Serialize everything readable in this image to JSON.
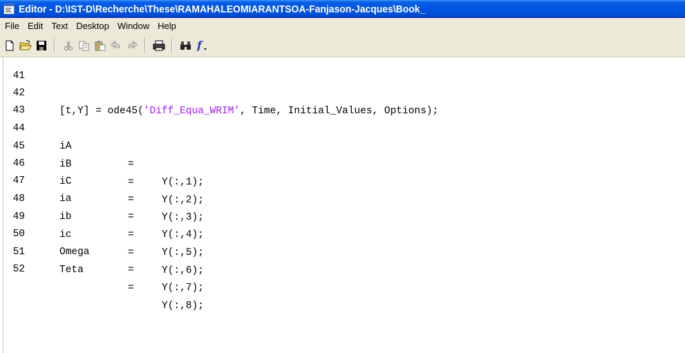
{
  "window": {
    "title": "Editor - D:\\IST-D\\Recherche\\These\\RAMAHALEOMIARANTSOA-Fanjason-Jacques\\Book_"
  },
  "menu": [
    "File",
    "Edit",
    "Text",
    "Desktop",
    "Window",
    "Help"
  ],
  "toolbar": {
    "groups": [
      [
        "new-file-icon",
        "open-folder-icon",
        "save-icon"
      ],
      [
        "cut-icon",
        "copy-icon",
        "paste-icon",
        "undo-icon",
        "redo-icon"
      ],
      [
        "print-icon"
      ],
      [
        "find-icon",
        "function-icon"
      ]
    ]
  },
  "editor": {
    "lines": [
      {
        "num": "41",
        "code": ""
      },
      {
        "num": "42",
        "pre": "[t,Y] = ode45(",
        "str": "'Diff_Equa_WRIM'",
        "post": ", Time, Initial_Values, Options);"
      },
      {
        "num": "43",
        "code": ""
      },
      {
        "num": "44",
        "var": "iA",
        "eq": "=",
        "val": "Y(:,1);"
      },
      {
        "num": "45",
        "var": "iB",
        "eq": "=",
        "val": "Y(:,2);"
      },
      {
        "num": "46",
        "var": "iC",
        "eq": "=",
        "val": "Y(:,3);"
      },
      {
        "num": "47",
        "var": "ia",
        "eq": "=",
        "val": "Y(:,4);"
      },
      {
        "num": "48",
        "var": "ib",
        "eq": "=",
        "val": "Y(:,5);"
      },
      {
        "num": "49",
        "var": "ic",
        "eq": "=",
        "val": "Y(:,6);"
      },
      {
        "num": "50",
        "var": "Omega",
        "eq": "=",
        "val": "Y(:,7);"
      },
      {
        "num": "51",
        "var": "Teta",
        "eq": "=",
        "val": "Y(:,8);"
      },
      {
        "num": "52",
        "code": ""
      }
    ]
  }
}
